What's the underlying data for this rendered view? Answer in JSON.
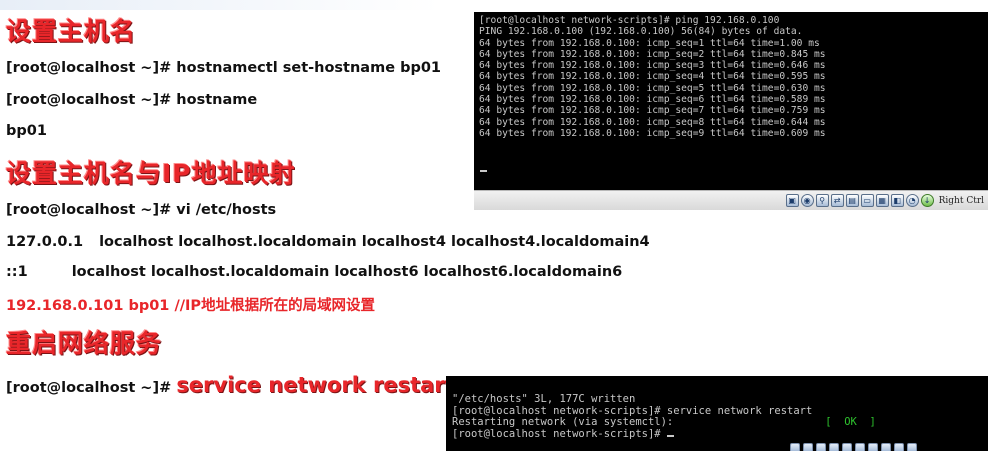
{
  "headings": {
    "set_hostname": "设置主机名",
    "host_ip_mapping": "设置主机名与IP地址映射",
    "restart_network": "重启网络服务"
  },
  "commands": {
    "set_hostname_cmd": "[root@localhost ~]# hostnamectl set-hostname bp01",
    "hostname_cmd": "[root@localhost ~]# hostname",
    "hostname_output": "bp01",
    "vi_hosts_cmd": "[root@localhost ~]# vi /etc/hosts",
    "hosts_line1_ip": "127.0.0.1",
    "hosts_line1_names": "localhost localhost.localdomain localhost4 localhost4.localdomain4",
    "hosts_line2_ip": "::1",
    "hosts_line2_names": "localhost localhost.localdomain localhost6 localhost6.localdomain6",
    "hosts_line3": "192.168.0.101 bp01     //IP地址根据所在的局域网设置",
    "restart_prompt": "[root@localhost ~]#",
    "restart_cmd": "service network restart"
  },
  "terminal_ping": {
    "lines": [
      "[root@localhost network-scripts]# ping 192.168.0.100",
      "PING 192.168.0.100 (192.168.0.100) 56(84) bytes of data.",
      "64 bytes from 192.168.0.100: icmp_seq=1 ttl=64 time=1.00 ms",
      "64 bytes from 192.168.0.100: icmp_seq=2 ttl=64 time=0.845 ms",
      "64 bytes from 192.168.0.100: icmp_seq=3 ttl=64 time=0.646 ms",
      "64 bytes from 192.168.0.100: icmp_seq=4 ttl=64 time=0.595 ms",
      "64 bytes from 192.168.0.100: icmp_seq=5 ttl=64 time=0.630 ms",
      "64 bytes from 192.168.0.100: icmp_seq=6 ttl=64 time=0.589 ms",
      "64 bytes from 192.168.0.100: icmp_seq=7 ttl=64 time=0.759 ms",
      "64 bytes from 192.168.0.100: icmp_seq=8 ttl=64 time=0.644 ms",
      "64 bytes from 192.168.0.100: icmp_seq=9 ttl=64 time=0.609 ms"
    ],
    "host_key_label": "Right Ctrl",
    "status_icons": [
      "hdd-icon",
      "cd-icon",
      "usb-icon",
      "network-icon",
      "shared-folder-icon",
      "display-icon",
      "video-capture-icon",
      "cpu-icon",
      "mouse-icon",
      "keyboard-capture-icon"
    ]
  },
  "terminal_restart": {
    "line1": "\"/etc/hosts\" 3L, 177C written",
    "line2": "[root@localhost network-scripts]# service network restart",
    "line3_text": "Restarting network (via systemctl):",
    "line3_status": "[  OK  ]",
    "line4": "[root@localhost network-scripts]# "
  }
}
